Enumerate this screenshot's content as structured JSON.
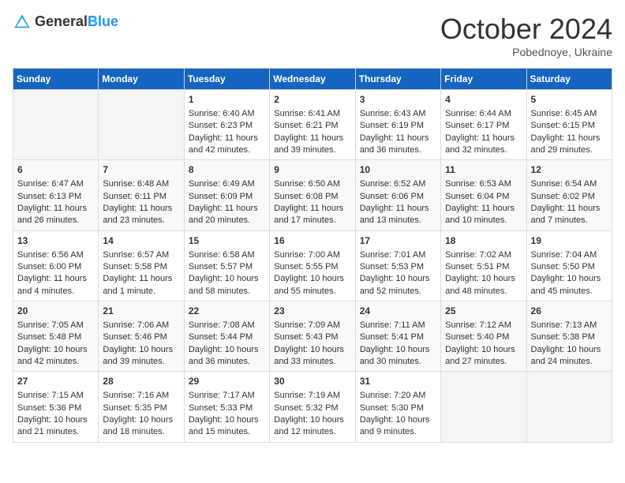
{
  "header": {
    "logo_general": "General",
    "logo_blue": "Blue",
    "month": "October 2024",
    "location": "Pobednoye, Ukraine"
  },
  "weekdays": [
    "Sunday",
    "Monday",
    "Tuesday",
    "Wednesday",
    "Thursday",
    "Friday",
    "Saturday"
  ],
  "weeks": [
    [
      {
        "day": "",
        "empty": true
      },
      {
        "day": "",
        "empty": true
      },
      {
        "day": "1",
        "sunrise": "Sunrise: 6:40 AM",
        "sunset": "Sunset: 6:23 PM",
        "daylight": "Daylight: 11 hours and 42 minutes."
      },
      {
        "day": "2",
        "sunrise": "Sunrise: 6:41 AM",
        "sunset": "Sunset: 6:21 PM",
        "daylight": "Daylight: 11 hours and 39 minutes."
      },
      {
        "day": "3",
        "sunrise": "Sunrise: 6:43 AM",
        "sunset": "Sunset: 6:19 PM",
        "daylight": "Daylight: 11 hours and 36 minutes."
      },
      {
        "day": "4",
        "sunrise": "Sunrise: 6:44 AM",
        "sunset": "Sunset: 6:17 PM",
        "daylight": "Daylight: 11 hours and 32 minutes."
      },
      {
        "day": "5",
        "sunrise": "Sunrise: 6:45 AM",
        "sunset": "Sunset: 6:15 PM",
        "daylight": "Daylight: 11 hours and 29 minutes."
      }
    ],
    [
      {
        "day": "6",
        "sunrise": "Sunrise: 6:47 AM",
        "sunset": "Sunset: 6:13 PM",
        "daylight": "Daylight: 11 hours and 26 minutes."
      },
      {
        "day": "7",
        "sunrise": "Sunrise: 6:48 AM",
        "sunset": "Sunset: 6:11 PM",
        "daylight": "Daylight: 11 hours and 23 minutes."
      },
      {
        "day": "8",
        "sunrise": "Sunrise: 6:49 AM",
        "sunset": "Sunset: 6:09 PM",
        "daylight": "Daylight: 11 hours and 20 minutes."
      },
      {
        "day": "9",
        "sunrise": "Sunrise: 6:50 AM",
        "sunset": "Sunset: 6:08 PM",
        "daylight": "Daylight: 11 hours and 17 minutes."
      },
      {
        "day": "10",
        "sunrise": "Sunrise: 6:52 AM",
        "sunset": "Sunset: 6:06 PM",
        "daylight": "Daylight: 11 hours and 13 minutes."
      },
      {
        "day": "11",
        "sunrise": "Sunrise: 6:53 AM",
        "sunset": "Sunset: 6:04 PM",
        "daylight": "Daylight: 11 hours and 10 minutes."
      },
      {
        "day": "12",
        "sunrise": "Sunrise: 6:54 AM",
        "sunset": "Sunset: 6:02 PM",
        "daylight": "Daylight: 11 hours and 7 minutes."
      }
    ],
    [
      {
        "day": "13",
        "sunrise": "Sunrise: 6:56 AM",
        "sunset": "Sunset: 6:00 PM",
        "daylight": "Daylight: 11 hours and 4 minutes."
      },
      {
        "day": "14",
        "sunrise": "Sunrise: 6:57 AM",
        "sunset": "Sunset: 5:58 PM",
        "daylight": "Daylight: 11 hours and 1 minute."
      },
      {
        "day": "15",
        "sunrise": "Sunrise: 6:58 AM",
        "sunset": "Sunset: 5:57 PM",
        "daylight": "Daylight: 10 hours and 58 minutes."
      },
      {
        "day": "16",
        "sunrise": "Sunrise: 7:00 AM",
        "sunset": "Sunset: 5:55 PM",
        "daylight": "Daylight: 10 hours and 55 minutes."
      },
      {
        "day": "17",
        "sunrise": "Sunrise: 7:01 AM",
        "sunset": "Sunset: 5:53 PM",
        "daylight": "Daylight: 10 hours and 52 minutes."
      },
      {
        "day": "18",
        "sunrise": "Sunrise: 7:02 AM",
        "sunset": "Sunset: 5:51 PM",
        "daylight": "Daylight: 10 hours and 48 minutes."
      },
      {
        "day": "19",
        "sunrise": "Sunrise: 7:04 AM",
        "sunset": "Sunset: 5:50 PM",
        "daylight": "Daylight: 10 hours and 45 minutes."
      }
    ],
    [
      {
        "day": "20",
        "sunrise": "Sunrise: 7:05 AM",
        "sunset": "Sunset: 5:48 PM",
        "daylight": "Daylight: 10 hours and 42 minutes."
      },
      {
        "day": "21",
        "sunrise": "Sunrise: 7:06 AM",
        "sunset": "Sunset: 5:46 PM",
        "daylight": "Daylight: 10 hours and 39 minutes."
      },
      {
        "day": "22",
        "sunrise": "Sunrise: 7:08 AM",
        "sunset": "Sunset: 5:44 PM",
        "daylight": "Daylight: 10 hours and 36 minutes."
      },
      {
        "day": "23",
        "sunrise": "Sunrise: 7:09 AM",
        "sunset": "Sunset: 5:43 PM",
        "daylight": "Daylight: 10 hours and 33 minutes."
      },
      {
        "day": "24",
        "sunrise": "Sunrise: 7:11 AM",
        "sunset": "Sunset: 5:41 PM",
        "daylight": "Daylight: 10 hours and 30 minutes."
      },
      {
        "day": "25",
        "sunrise": "Sunrise: 7:12 AM",
        "sunset": "Sunset: 5:40 PM",
        "daylight": "Daylight: 10 hours and 27 minutes."
      },
      {
        "day": "26",
        "sunrise": "Sunrise: 7:13 AM",
        "sunset": "Sunset: 5:38 PM",
        "daylight": "Daylight: 10 hours and 24 minutes."
      }
    ],
    [
      {
        "day": "27",
        "sunrise": "Sunrise: 7:15 AM",
        "sunset": "Sunset: 5:36 PM",
        "daylight": "Daylight: 10 hours and 21 minutes."
      },
      {
        "day": "28",
        "sunrise": "Sunrise: 7:16 AM",
        "sunset": "Sunset: 5:35 PM",
        "daylight": "Daylight: 10 hours and 18 minutes."
      },
      {
        "day": "29",
        "sunrise": "Sunrise: 7:17 AM",
        "sunset": "Sunset: 5:33 PM",
        "daylight": "Daylight: 10 hours and 15 minutes."
      },
      {
        "day": "30",
        "sunrise": "Sunrise: 7:19 AM",
        "sunset": "Sunset: 5:32 PM",
        "daylight": "Daylight: 10 hours and 12 minutes."
      },
      {
        "day": "31",
        "sunrise": "Sunrise: 7:20 AM",
        "sunset": "Sunset: 5:30 PM",
        "daylight": "Daylight: 10 hours and 9 minutes."
      },
      {
        "day": "",
        "empty": true
      },
      {
        "day": "",
        "empty": true
      }
    ]
  ]
}
